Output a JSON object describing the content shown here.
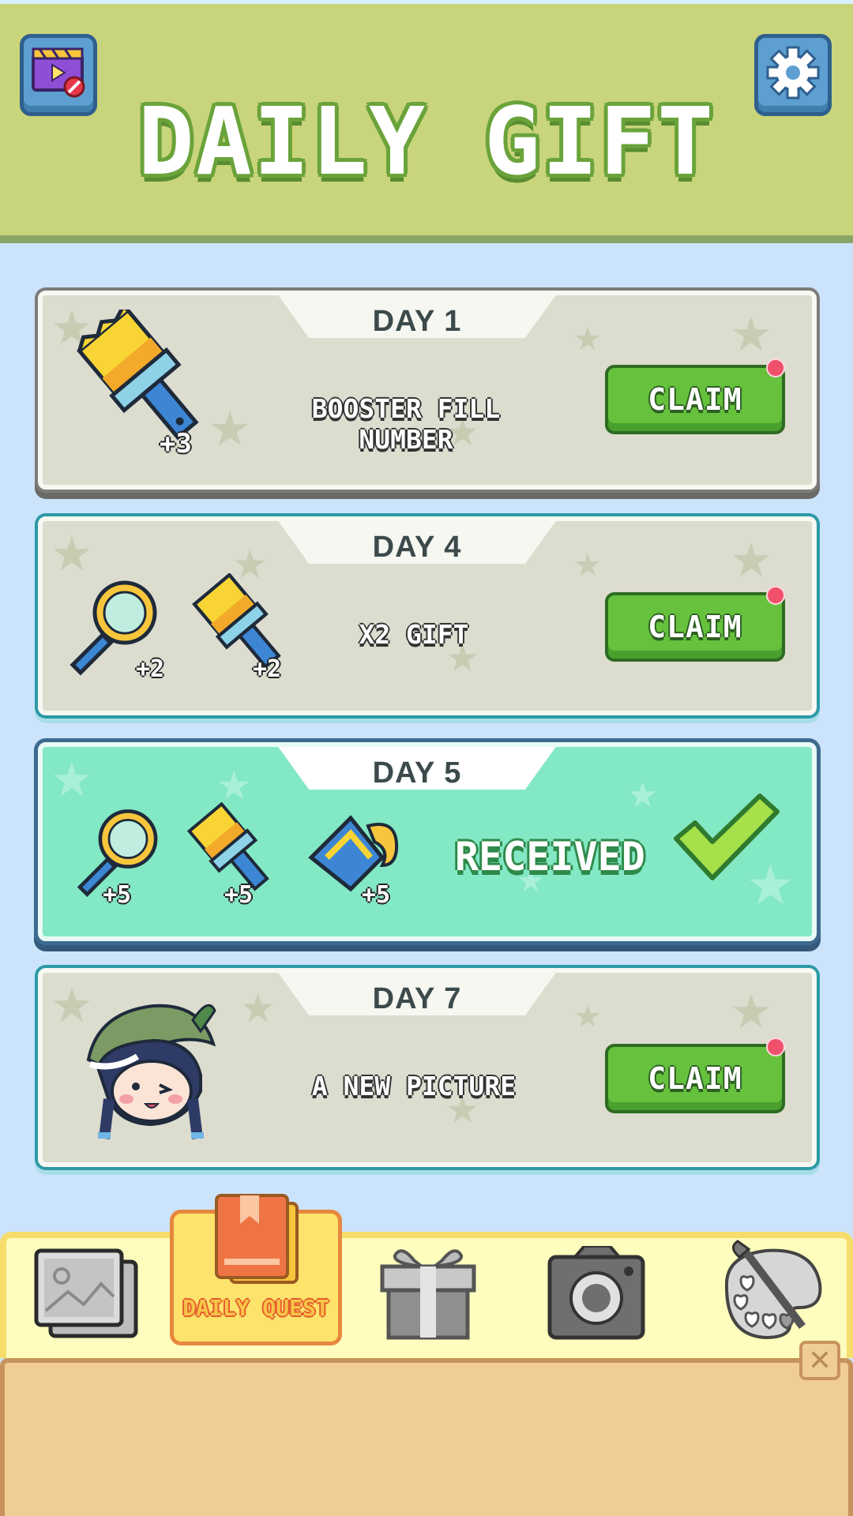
{
  "header": {
    "title": "DAILY GIFT",
    "left_icon": "video-ad-blocked-icon",
    "right_icon": "gear-icon"
  },
  "gifts": [
    {
      "day_label": "DAY 1",
      "description": "BOOSTER FILL NUMBER",
      "rewards": [
        {
          "icon": "paintbrush-icon",
          "amount": "+3"
        }
      ],
      "action_label": "CLAIM",
      "status": "claimable"
    },
    {
      "day_label": "DAY 4",
      "description": "X2 GIFT",
      "rewards": [
        {
          "icon": "magnifier-icon",
          "amount": "+2"
        },
        {
          "icon": "paintbrush-icon",
          "amount": "+2"
        }
      ],
      "action_label": "CLAIM",
      "status": "claimable"
    },
    {
      "day_label": "DAY 5",
      "description": "RECEIVED",
      "rewards": [
        {
          "icon": "magnifier-icon",
          "amount": "+5"
        },
        {
          "icon": "paintbrush-icon",
          "amount": "+5"
        },
        {
          "icon": "paint-bucket-icon",
          "amount": "+5"
        }
      ],
      "status": "received"
    },
    {
      "day_label": "DAY 7",
      "description": "A NEW PICTURE",
      "rewards": [
        {
          "icon": "character-picture-icon"
        }
      ],
      "action_label": "CLAIM",
      "status": "claimable"
    }
  ],
  "nav": {
    "active_label": "DAILY QUEST",
    "items": [
      "gallery-icon",
      "daily-quest-book-icon",
      "gift-box-icon",
      "camera-icon",
      "palette-icon"
    ]
  },
  "colors": {
    "header_bg": "#c9d57a",
    "page_bg": "#cbe4fb",
    "claim_green": "#66c23d",
    "received_bg": "#83e8c4",
    "notification_dot": "#f0506b"
  }
}
